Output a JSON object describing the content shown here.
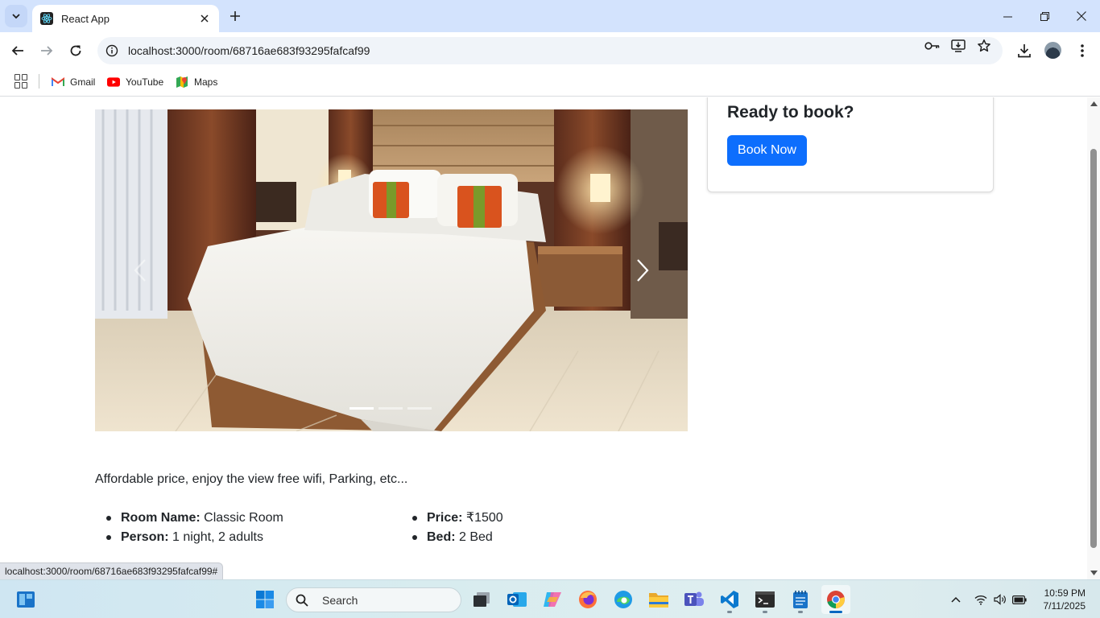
{
  "browser": {
    "tab_title": "React App",
    "url": "localhost:3000/room/68716ae683f93295fafcaf99",
    "status_url": "localhost:3000/room/68716ae683f93295fafcaf99#"
  },
  "bookmarks": [
    {
      "label": "Gmail",
      "icon": "gmail-icon"
    },
    {
      "label": "YouTube",
      "icon": "youtube-icon"
    },
    {
      "label": "Maps",
      "icon": "maps-icon"
    }
  ],
  "booking": {
    "heading": "Ready to book?",
    "button_label": "Book Now",
    "button_color": "#0d6efd"
  },
  "carousel": {
    "slide_count": 3,
    "active_index": 0
  },
  "room": {
    "description": "Affordable price, enjoy the view free wifi, Parking, etc...",
    "name_label": "Room Name:",
    "name_value": " Classic Room",
    "person_label": "Person:",
    "person_value": " 1 night, 2 adults",
    "price_label": "Price:",
    "price_value": " ₹1500",
    "bed_label": "Bed:",
    "bed_value": " 2 Bed"
  },
  "taskbar": {
    "search_placeholder": "Search",
    "time": "10:59 PM",
    "date": "7/11/2025"
  }
}
